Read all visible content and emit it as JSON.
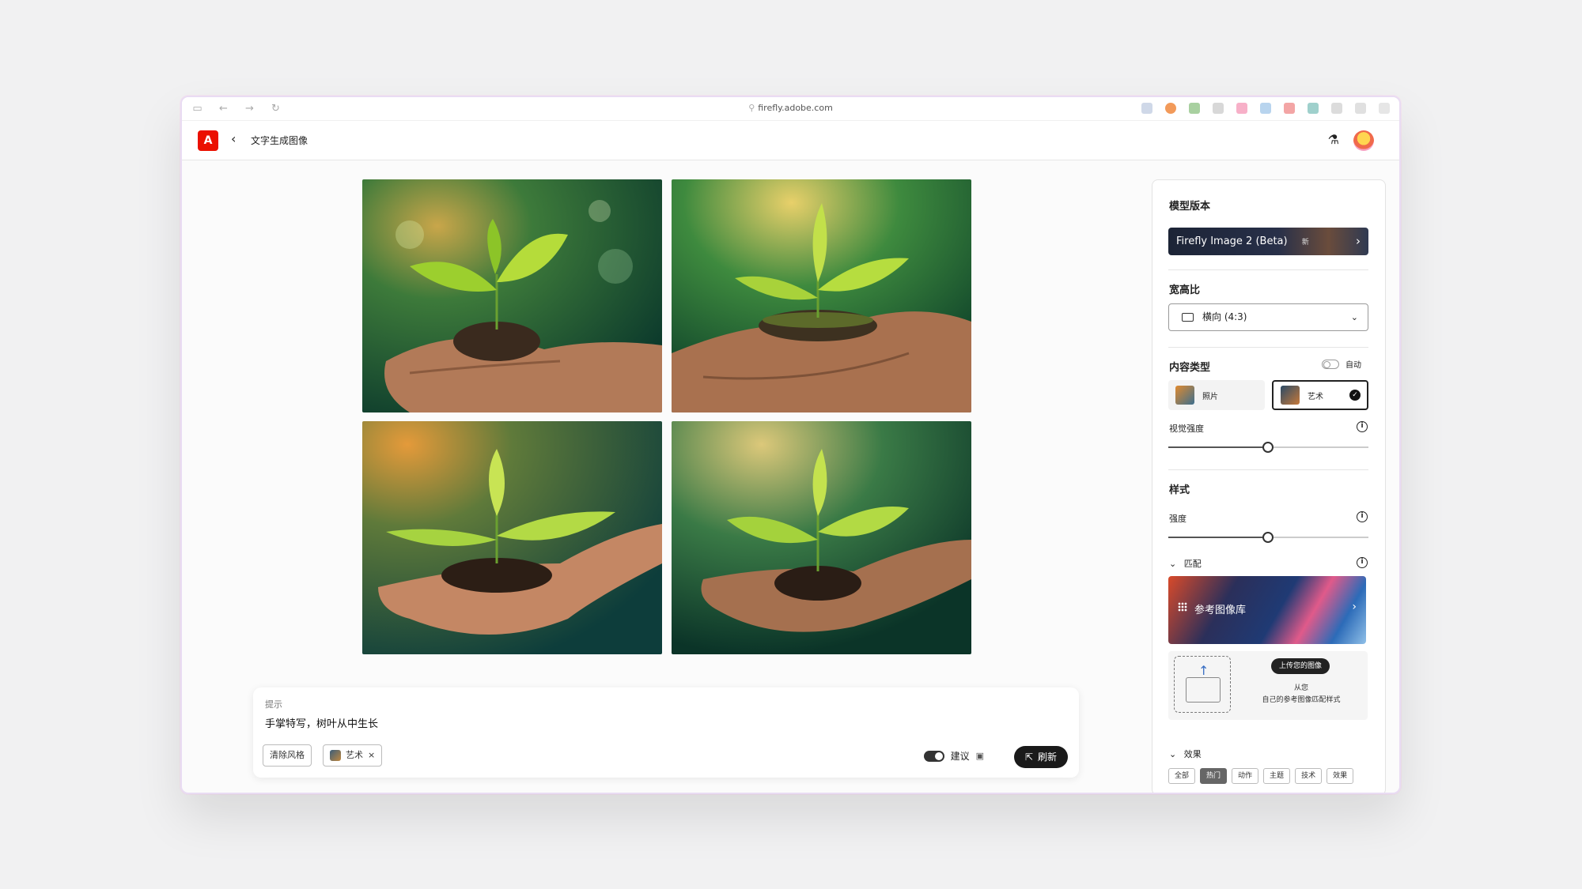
{
  "browser": {
    "url": "firefly.adobe.com"
  },
  "app": {
    "title": "文字生成图像"
  },
  "prompt": {
    "label": "提示",
    "text": "手掌特写，树叶从中生长",
    "clear_style_label": "清除风格",
    "art_chip_label": "艺术",
    "chip_remove": "×",
    "suggest_label": "建议",
    "refresh_label": "刷新"
  },
  "panel": {
    "model": {
      "heading": "模型版本",
      "value": "Firefly Image 2 (Beta)",
      "badge": "新"
    },
    "aspect": {
      "heading": "宽高比",
      "value": "横向 (4:3)"
    },
    "content_type": {
      "heading": "内容类型",
      "auto_label": "自动",
      "photo_label": "照片",
      "art_label": "艺术",
      "selected": "艺术"
    },
    "visual_intensity": {
      "label": "视觉强度",
      "value": 0.5
    },
    "style": {
      "heading": "样式",
      "strength_label": "强度",
      "strength_value": 0.5
    },
    "match": {
      "heading": "匹配",
      "gallery_label": "参考图像库",
      "upload_button": "上传您的图像",
      "upload_line1": "从您",
      "upload_line2": "自己的参考图像匹配样式"
    },
    "effects": {
      "heading": "效果",
      "tabs": [
        "全部",
        "热门",
        "动作",
        "主题",
        "技术",
        "效果"
      ],
      "active": "热门"
    }
  },
  "colors": {
    "adobe_red": "#eb1000",
    "accent_dark": "#1a1a1a"
  }
}
